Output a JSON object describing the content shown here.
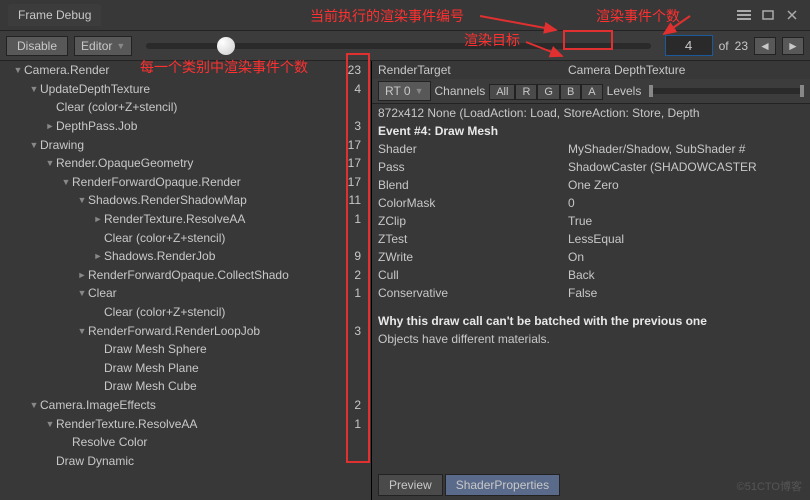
{
  "title": "Frame Debug",
  "annotations": {
    "event_index_label": "当前执行的渲染事件编号",
    "event_count_label": "渲染事件个数",
    "render_target_label": "渲染目标",
    "per_category_label": "每一个类别中渲染事件个数"
  },
  "toolbar": {
    "disable": "Disable",
    "target": "Editor",
    "current_event": "4",
    "of": "of",
    "total_events": "23"
  },
  "tree": [
    {
      "d": 0,
      "a": "down",
      "t": "Camera.Render",
      "c": "23"
    },
    {
      "d": 1,
      "a": "down",
      "t": "UpdateDepthTexture",
      "c": "4"
    },
    {
      "d": 2,
      "a": "",
      "t": "Clear (color+Z+stencil)",
      "c": ""
    },
    {
      "d": 2,
      "a": "right",
      "t": "DepthPass.Job",
      "c": "3"
    },
    {
      "d": 1,
      "a": "down",
      "t": "Drawing",
      "c": "17"
    },
    {
      "d": 2,
      "a": "down",
      "t": "Render.OpaqueGeometry",
      "c": "17"
    },
    {
      "d": 3,
      "a": "down",
      "t": "RenderForwardOpaque.Render",
      "c": "17"
    },
    {
      "d": 4,
      "a": "down",
      "t": "Shadows.RenderShadowMap",
      "c": "11"
    },
    {
      "d": 5,
      "a": "right",
      "t": "RenderTexture.ResolveAA",
      "c": "1"
    },
    {
      "d": 5,
      "a": "",
      "t": "Clear (color+Z+stencil)",
      "c": ""
    },
    {
      "d": 5,
      "a": "right",
      "t": "Shadows.RenderJob",
      "c": "9"
    },
    {
      "d": 4,
      "a": "right",
      "t": "RenderForwardOpaque.CollectShadows",
      "c": "2",
      "trunc": true
    },
    {
      "d": 4,
      "a": "down",
      "t": "Clear",
      "c": "1"
    },
    {
      "d": 5,
      "a": "",
      "t": "Clear (color+Z+stencil)",
      "c": ""
    },
    {
      "d": 4,
      "a": "down",
      "t": "RenderForward.RenderLoopJob",
      "c": "3"
    },
    {
      "d": 5,
      "a": "",
      "t": "Draw Mesh Sphere",
      "c": ""
    },
    {
      "d": 5,
      "a": "",
      "t": "Draw Mesh Plane",
      "c": ""
    },
    {
      "d": 5,
      "a": "",
      "t": "Draw Mesh Cube",
      "c": ""
    },
    {
      "d": 1,
      "a": "down",
      "t": "Camera.ImageEffects",
      "c": "2"
    },
    {
      "d": 2,
      "a": "down",
      "t": "RenderTexture.ResolveAA",
      "c": "1"
    },
    {
      "d": 3,
      "a": "",
      "t": "Resolve Color",
      "c": ""
    },
    {
      "d": 2,
      "a": "",
      "t": "Draw Dynamic",
      "c": ""
    }
  ],
  "detail": {
    "render_target_label": "RenderTarget",
    "render_target_value": "Camera DepthTexture",
    "rt_dropdown": "RT 0",
    "channels_label": "Channels",
    "channels": [
      "All",
      "R",
      "G",
      "B",
      "A"
    ],
    "levels_label": "Levels",
    "info_line": "872x412 None (LoadAction: Load, StoreAction: Store, Depth",
    "event_title": "Event #4: Draw Mesh",
    "props": [
      {
        "k": "Shader",
        "v": "MyShader/Shadow, SubShader #"
      },
      {
        "k": "Pass",
        "v": "ShadowCaster (SHADOWCASTER"
      },
      {
        "k": "Blend",
        "v": "One Zero"
      },
      {
        "k": "ColorMask",
        "v": "0"
      },
      {
        "k": "ZClip",
        "v": "True"
      },
      {
        "k": "ZTest",
        "v": "LessEqual"
      },
      {
        "k": "ZWrite",
        "v": "On"
      },
      {
        "k": "Cull",
        "v": "Back"
      },
      {
        "k": "Conservative",
        "v": "False"
      }
    ],
    "batch_title": "Why this draw call can't be batched with the previous one",
    "batch_reason": "Objects have different materials.",
    "tabs": {
      "preview": "Preview",
      "shaderprops": "ShaderProperties"
    }
  },
  "watermark": "©51CTO博客"
}
